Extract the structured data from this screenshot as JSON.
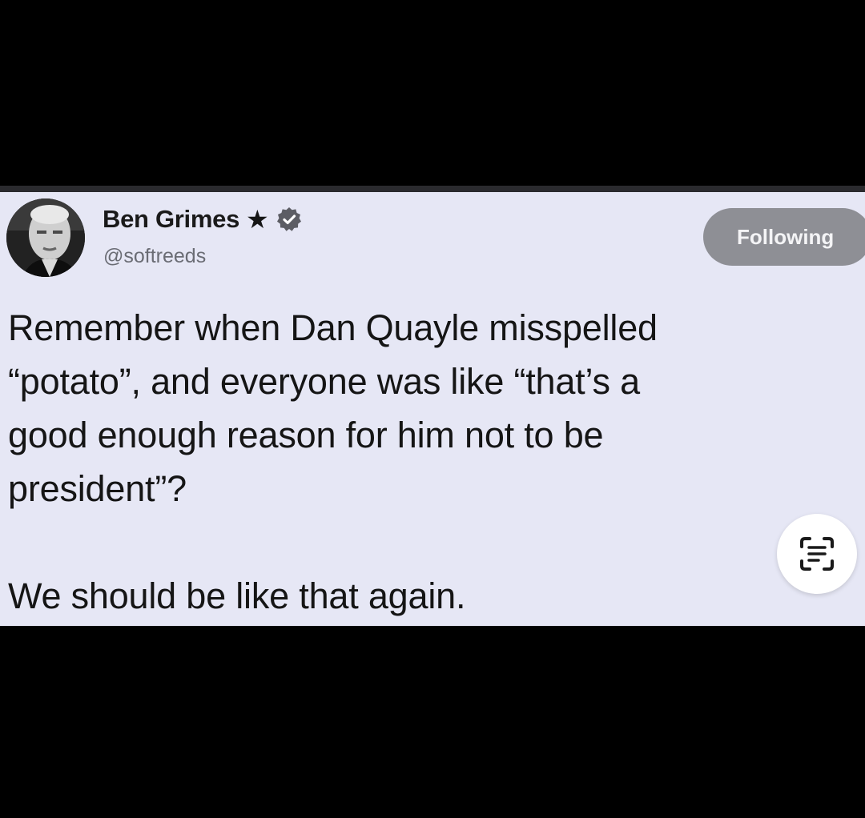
{
  "tweet": {
    "author_name": "Ben Grimes",
    "author_handle": "@softreeds",
    "star_glyph": "★",
    "follow_button_label": "Following",
    "text_lines": [
      "Remember when Dan Quayle misspelled",
      "“potato”, and everyone was like “that’s a",
      "good enough reason for him not to be",
      "president”?"
    ],
    "text_last_line": "We should be like that again."
  },
  "icons": {
    "verified": "verified-badge-icon",
    "lens": "text-scan-icon",
    "star": "star-icon"
  },
  "colors": {
    "card_background": "#e6e7f5",
    "outer_background": "#000000",
    "follow_button": "#8e8f95",
    "verified_badge": "#5c5d64"
  }
}
